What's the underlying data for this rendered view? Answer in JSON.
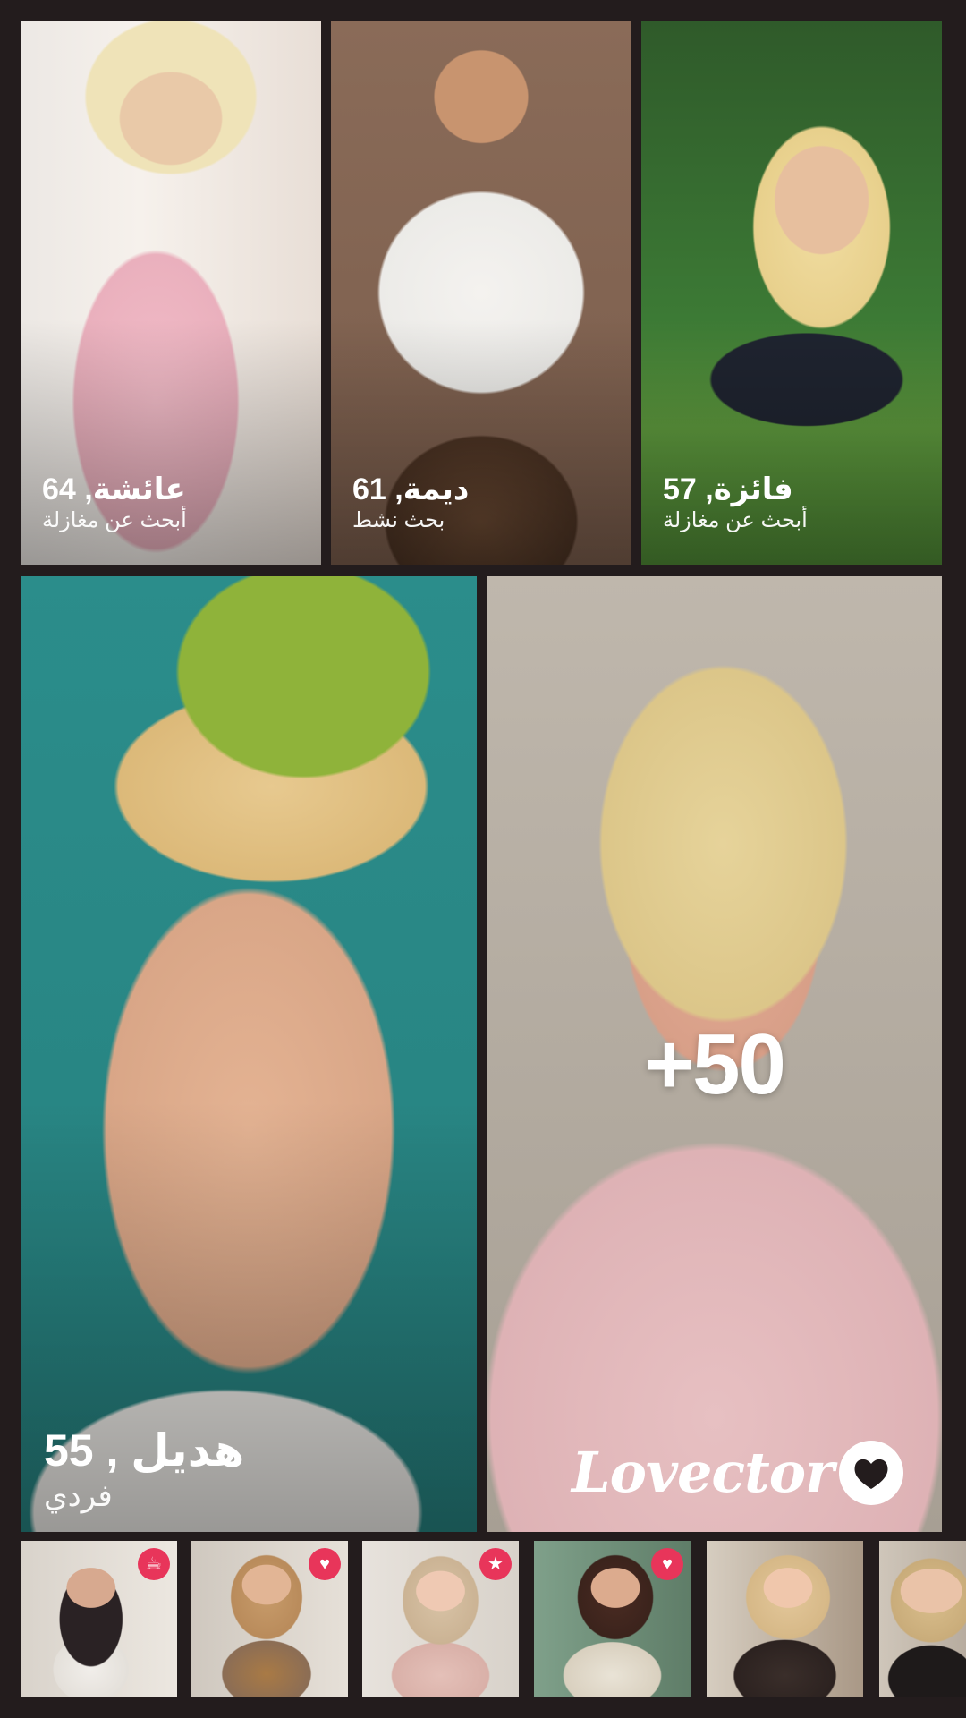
{
  "top_cards": [
    {
      "name": "عائشة, 64",
      "tagline": "أبحث عن مغازلة"
    },
    {
      "name": "ديمة, 61",
      "tagline": "بحث نشط"
    },
    {
      "name": "فائزة, 57",
      "tagline": "أبحث عن مغازلة"
    }
  ],
  "feature_card": {
    "name": "هديل , 55",
    "tagline": "فردي"
  },
  "more_card": {
    "count_label": "+50",
    "brand": "Lovector"
  },
  "thumbnails": [
    {
      "badge_icon": "cup-icon",
      "badge_glyph": "☕"
    },
    {
      "badge_icon": "heart-icon",
      "badge_glyph": "♥"
    },
    {
      "badge_icon": "star-icon",
      "badge_glyph": "★"
    },
    {
      "badge_icon": "heart-icon",
      "badge_glyph": "♥"
    },
    {
      "badge_icon": "",
      "badge_glyph": ""
    },
    {
      "badge_icon": "",
      "badge_glyph": ""
    }
  ],
  "colors": {
    "background": "#231c1d",
    "badge": "#e8355a",
    "text": "#ffffff"
  }
}
